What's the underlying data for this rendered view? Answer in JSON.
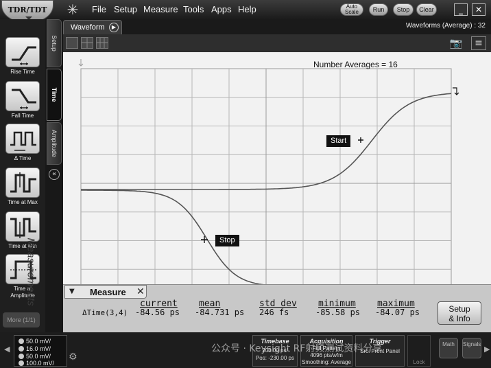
{
  "app": {
    "logo": "TDR/TDT",
    "menu": [
      "File",
      "Setup",
      "Measure",
      "Tools",
      "Apps",
      "Help"
    ],
    "buttons": {
      "auto_scale": "Auto Scale",
      "run": "Run",
      "stop": "Stop",
      "clear": "Clear"
    },
    "window": {
      "minimize": "_",
      "close": "✕"
    }
  },
  "left_toolbar": {
    "tools": [
      {
        "label": "Rise Time",
        "icon": "rise-time-icon"
      },
      {
        "label": "Fall Time",
        "icon": "fall-time-icon"
      },
      {
        "label": "Δ Time",
        "icon": "delta-time-icon"
      },
      {
        "label": "Time at Max",
        "icon": "time-at-max-icon"
      },
      {
        "label": "Time at Min",
        "icon": "time-at-min-icon"
      },
      {
        "label": "Time at Amplitude",
        "icon": "time-at-amplitude-icon"
      }
    ],
    "more": "More (1/1)"
  },
  "side_tabs": {
    "setup": "Setup",
    "time": "Time",
    "amplitude": "Amplitude",
    "measurements": "Measurements"
  },
  "waveform": {
    "tab_label": "Waveform",
    "count_text": "Waveforms (Average) : 32",
    "num_averages": "Number Averages = 16",
    "markers": {
      "start": "Start",
      "stop": "Stop"
    },
    "colors": {
      "background": "#f2f2f2",
      "grid": "#b5b5b5",
      "trace": "#555555"
    }
  },
  "measure": {
    "title": "Measure",
    "headers": [
      "current",
      "mean",
      "std dev",
      "minimum",
      "maximum"
    ],
    "name": "ΔTime(3,4)",
    "values": [
      "-84.56 ps",
      "-84.731 ps",
      "246 fs",
      "-85.58 ps",
      "-84.07 ps"
    ],
    "setup_info": [
      "Setup",
      "& Info"
    ]
  },
  "status": {
    "channels": [
      "50.0 mV/",
      "16.0 mV/",
      "50.0 mV/",
      "100.0 mV/"
    ],
    "timebase": {
      "title": "Timebase",
      "lines": [
        "200.00 ps/",
        "Pos: -230.00 ps"
      ]
    },
    "acquisition": {
      "title": "Acquisition",
      "lines": [
        "Full Pattern",
        "4096 pts/wfm",
        "Smoothing: Average"
      ]
    },
    "trigger": {
      "title": "Trigger",
      "lines": [
        "Src: Front Panel",
        "Lock"
      ]
    },
    "buttons": {
      "math": "Math",
      "signals": "Signals"
    },
    "watermark": "公众号 · Keysight RF射频测试资料分享"
  }
}
